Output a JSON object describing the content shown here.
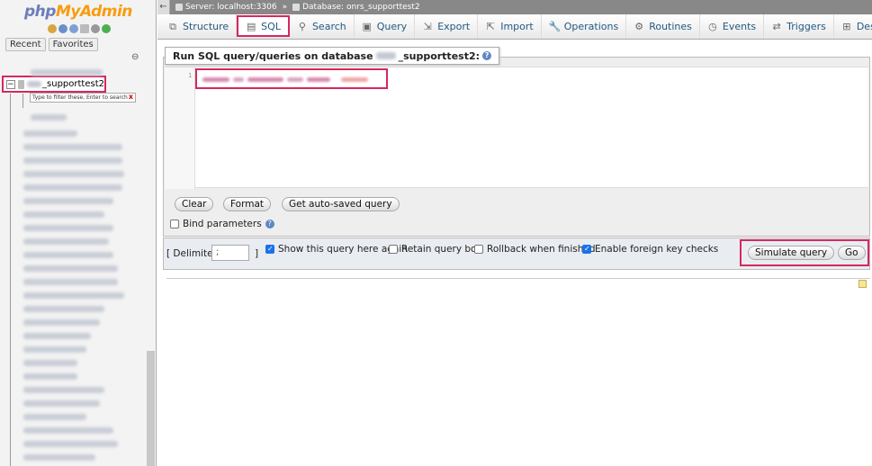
{
  "nav": {
    "logo_php": "php",
    "logo_myadmin": "MyAdmin",
    "tabs": [
      "Recent",
      "Favorites"
    ],
    "database": {
      "name": "_supporttest2",
      "filter_placeholder": "Type to filter these, Enter to search",
      "filter_clear": "x"
    }
  },
  "topbar": {
    "collapse": "←",
    "server": "Server: localhost:3306",
    "separator": "»",
    "database": "Database: onrs_supporttest2"
  },
  "menu": [
    {
      "label": "Structure",
      "icon": "structure-icon",
      "glyph": "⧉"
    },
    {
      "label": "SQL",
      "icon": "sql-icon",
      "glyph": "▤"
    },
    {
      "label": "Search",
      "icon": "search-icon",
      "glyph": "⚲"
    },
    {
      "label": "Query",
      "icon": "query-icon",
      "glyph": "▣"
    },
    {
      "label": "Export",
      "icon": "export-icon",
      "glyph": "⇲"
    },
    {
      "label": "Import",
      "icon": "import-icon",
      "glyph": "⇱"
    },
    {
      "label": "Operations",
      "icon": "wrench-icon",
      "glyph": "🔧"
    },
    {
      "label": "Routines",
      "icon": "routines-icon",
      "glyph": "⚙"
    },
    {
      "label": "Events",
      "icon": "clock-icon",
      "glyph": "◷"
    },
    {
      "label": "Triggers",
      "icon": "triggers-icon",
      "glyph": "⇄"
    },
    {
      "label": "Designer",
      "icon": "designer-icon",
      "glyph": "⊞"
    }
  ],
  "sql": {
    "legend_prefix": "Run SQL query/queries on database",
    "legend_db": "_supporttest2:",
    "line_number": "1",
    "buttons": {
      "clear": "Clear",
      "format": "Format",
      "autosaved": "Get auto-saved query"
    },
    "bind_parameters": "Bind parameters"
  },
  "options": {
    "delimiter_label": "[ Delimiter",
    "delimiter_value": ";",
    "delimiter_close": "]",
    "show_query": "Show this query here again",
    "retain_box": "Retain query box",
    "rollback": "Rollback when finished",
    "foreign_keys": "Enable foreign key checks",
    "simulate": "Simulate query",
    "go": "Go"
  },
  "colors": {
    "highlight": "#d6285d",
    "link": "#235a81",
    "checked": "#1a73e8"
  }
}
